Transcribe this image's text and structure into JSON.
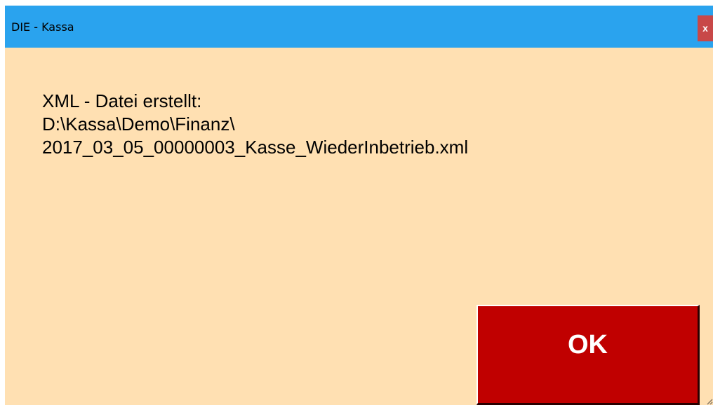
{
  "window": {
    "title": "DIE - Kassa",
    "close_label": "x",
    "background_color": "#ffe0b2",
    "titlebar_color": "#2aa3ee"
  },
  "message": {
    "lines": [
      "XML - Datei erstellt:",
      "D:\\Kassa\\Demo\\Finanz\\",
      "2017_03_05_00000003_Kasse_WiederInbetrieb.xml"
    ]
  },
  "ok_button": {
    "label": "OK",
    "color": "#c00000"
  },
  "icons": {
    "close": "close-icon",
    "resize": "resize-grip-icon"
  }
}
